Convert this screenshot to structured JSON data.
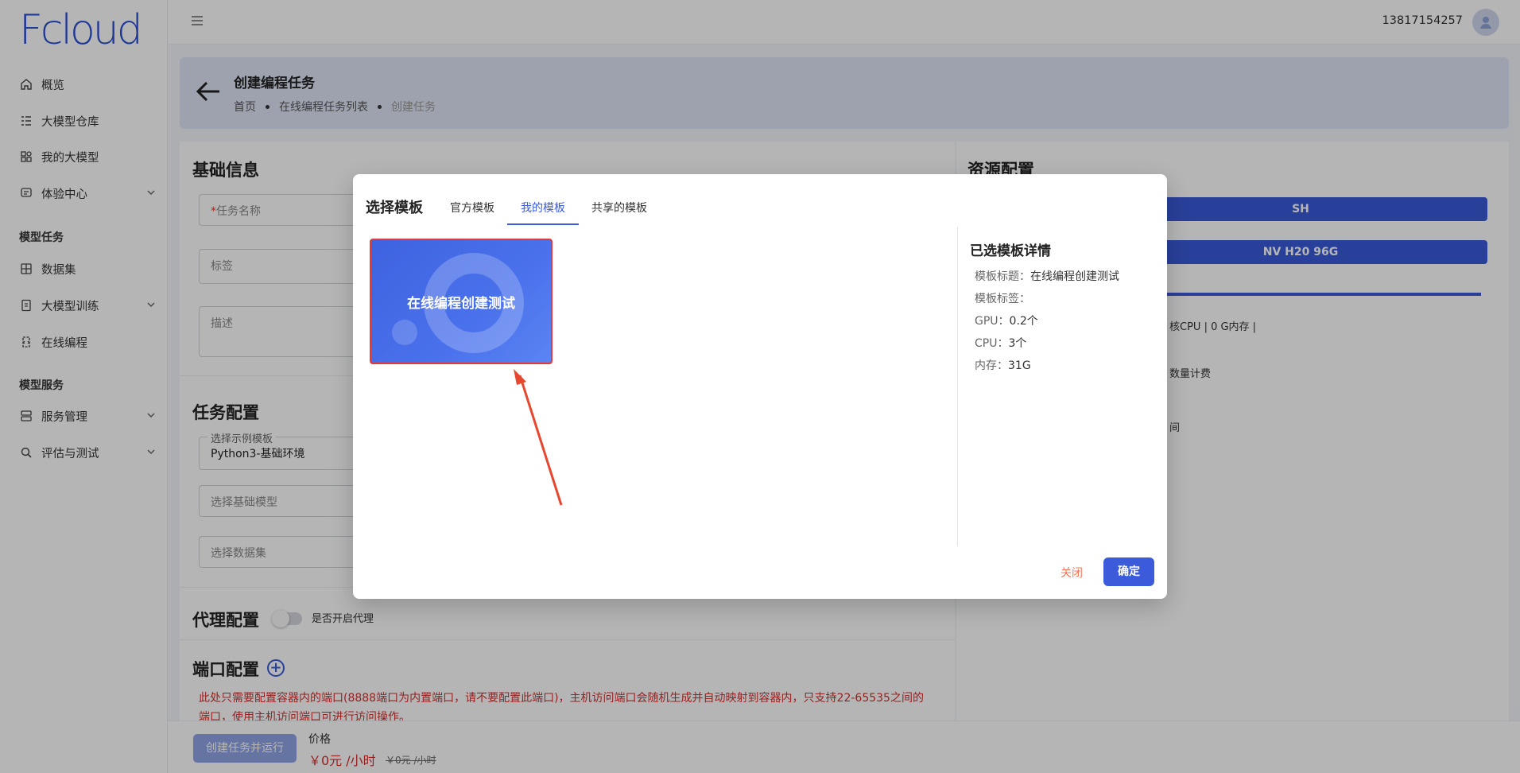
{
  "brand": {
    "logo_text": "Fcloud"
  },
  "sidebar": {
    "items": [
      {
        "label": "概览",
        "icon": "home-icon"
      },
      {
        "label": "大模型仓库",
        "icon": "list-icon"
      },
      {
        "label": "我的大模型",
        "icon": "apps-icon"
      },
      {
        "label": "体验中心",
        "icon": "chat-icon"
      }
    ],
    "section_tasks": "模型任务",
    "task_items": [
      {
        "label": "数据集",
        "icon": "grid-icon"
      },
      {
        "label": "大模型训练",
        "icon": "file-icon"
      },
      {
        "label": "在线编程",
        "icon": "code-icon"
      }
    ],
    "section_services": "模型服务",
    "service_items": [
      {
        "label": "服务管理",
        "icon": "server-icon"
      },
      {
        "label": "评估与测试",
        "icon": "search-icon"
      }
    ]
  },
  "topbar": {
    "user_phone": "13817154257"
  },
  "header": {
    "title": "创建编程任务",
    "breadcrumb": [
      "首页",
      "在线编程任务列表",
      "创建任务"
    ]
  },
  "form": {
    "basic_title": "基础信息",
    "task_name_placeholder": "任务名称",
    "tags_placeholder": "标签",
    "desc_placeholder": "描述",
    "task_config_title": "任务配置",
    "example_template_legend": "选择示例模板",
    "example_template_value": "Python3-基础环境",
    "base_model_placeholder": "选择基础模型",
    "dataset_placeholder": "选择数据集",
    "proxy_title": "代理配置",
    "proxy_toggle_label": "是否开启代理",
    "port_title": "端口配置",
    "port_warning": "此处只需要配置容器内的端口(8888端口为内置端口，请不要配置此端口)，主机访问端口会随机生成并自动映射到容器内，只支持22-65535之间的端口，使用主机访问端口可进行访问操作。"
  },
  "resources": {
    "title": "资源配置",
    "region": "SH",
    "gpu_type": "NV H20 96G",
    "spec_text": "核CPU | 0 G内存 |",
    "billing_text": "数量计费",
    "time_text": "间"
  },
  "footer": {
    "run_button": "创建任务并运行",
    "price_label": "价格",
    "price_value": "￥0元 /小时",
    "price_original": "￥0元 /小时"
  },
  "modal": {
    "title": "选择模板",
    "tabs": [
      "官方模板",
      "我的模板",
      "共享的模板"
    ],
    "active_tab": 1,
    "card_label": "在线编程创建测试",
    "detail_title": "已选模板详情",
    "details": [
      {
        "key": "模板标题：",
        "value": "在线编程创建测试"
      },
      {
        "key": "模板标签：",
        "value": ""
      },
      {
        "key": "GPU：",
        "value": "0.2个"
      },
      {
        "key": "CPU：",
        "value": "3个"
      },
      {
        "key": "内存：",
        "value": "31G"
      }
    ],
    "close_label": "关闭",
    "ok_label": "确定"
  },
  "colors": {
    "accent": "#3b5bdb",
    "danger": "#e53935",
    "close": "#f0765a"
  }
}
